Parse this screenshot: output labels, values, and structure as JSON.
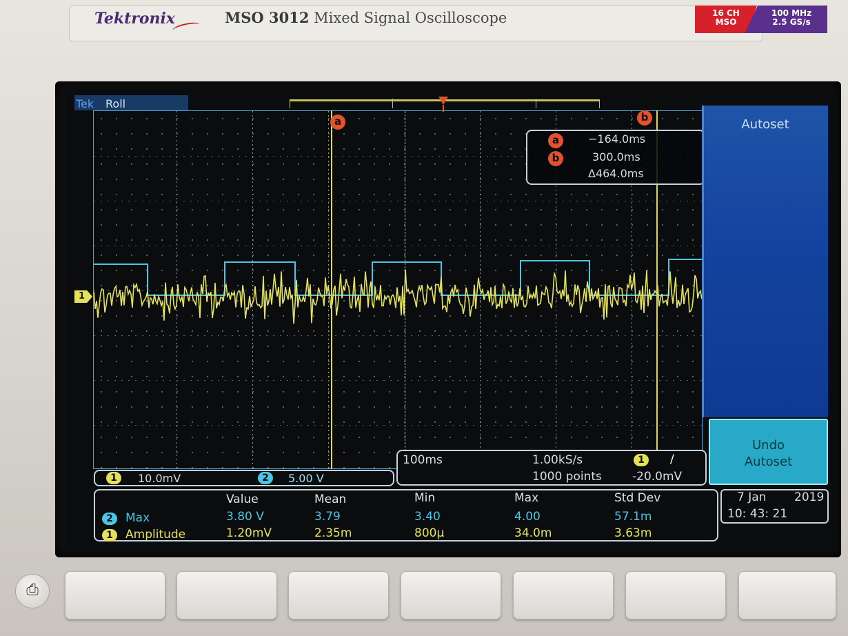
{
  "header": {
    "brand": "Tektronix",
    "model_number": "MSO 3012",
    "model_desc": "Mixed Signal Oscilloscope",
    "badge_left": [
      "16 CH",
      "MSO"
    ],
    "badge_right": [
      "100 MHz",
      "2.5 GS/s"
    ]
  },
  "status": {
    "brand_short": "Tek",
    "mode": "Roll"
  },
  "cursors": {
    "a_label": "a",
    "b_label": "b",
    "a_value": "−164.0ms",
    "b_value": "300.0ms",
    "delta_value": "Δ464.0ms"
  },
  "channel_marker": "1",
  "side_menu": {
    "title": "Autoset",
    "undo_line1": "Undo",
    "undo_line2": "Autoset"
  },
  "scale": {
    "ch1_badge": "1",
    "ch1_scale": "10.0mV",
    "ch2_badge": "2",
    "ch2_scale": "5.00 V"
  },
  "timebase": {
    "time_per_div": "100ms",
    "sample_rate": "1.00kS/s",
    "record_length": "1000 points",
    "trigger_channel": "1",
    "trigger_slope": "∕",
    "trigger_level": "-20.0mV"
  },
  "measurements": {
    "headers": [
      "Value",
      "Mean",
      "Min",
      "Max",
      "Std Dev"
    ],
    "rows": [
      {
        "ch": "2",
        "name": "Max",
        "values": [
          "3.80 V",
          "3.79",
          "3.40",
          "4.00",
          "57.1m"
        ]
      },
      {
        "ch": "1",
        "name": "Amplitude",
        "values": [
          "1.20mV",
          "2.35m",
          "800µ",
          "34.0m",
          "3.63m"
        ]
      }
    ]
  },
  "datetime": {
    "date_day": "7 Jan",
    "year": "2019",
    "time": "10: 43: 21"
  },
  "icons": {
    "print": "printer-icon"
  },
  "colors": {
    "ch1": "#e4e25c",
    "ch2": "#49c5e6",
    "cursor_tag": "#e2522f",
    "menu_blue": "#1444a0"
  }
}
